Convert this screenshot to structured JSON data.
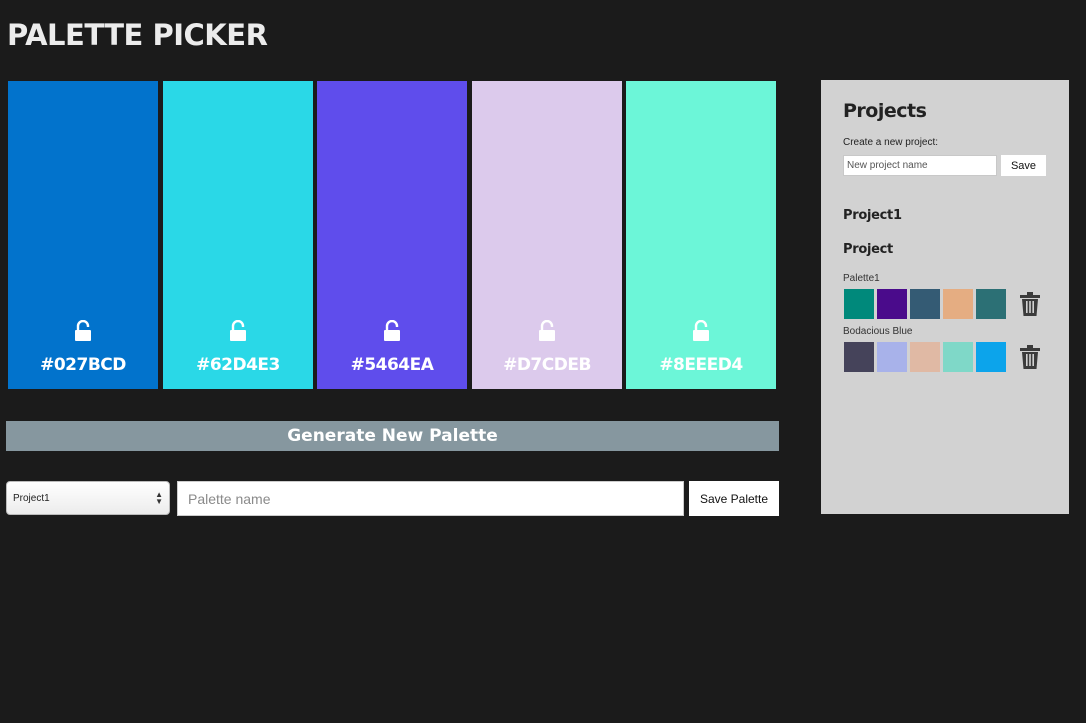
{
  "app": {
    "title": "PALETTE PICKER"
  },
  "swatches": [
    {
      "color": "#0273CC",
      "hex": "#027BCD",
      "icon": "unlock-icon"
    },
    {
      "color": "#2AD8E7",
      "hex": "#62D4E3",
      "icon": "unlock-icon"
    },
    {
      "color": "#5F4DEC",
      "hex": "#5464EA",
      "icon": "unlock-icon"
    },
    {
      "color": "#DCCAEC",
      "hex": "#D7CDEB",
      "icon": "unlock-icon"
    },
    {
      "color": "#6CF6D8",
      "hex": "#8EEED4",
      "icon": "unlock-icon"
    }
  ],
  "controls": {
    "generate_label": "Generate New Palette",
    "project_select_value": "Project1",
    "palette_name_placeholder": "Palette name",
    "save_palette_label": "Save Palette"
  },
  "sidebar": {
    "heading": "Projects",
    "create_label": "Create a new project:",
    "new_project_placeholder": "New project name",
    "save_label": "Save",
    "projects": [
      {
        "name": "Project1",
        "palettes": []
      },
      {
        "name": "Project",
        "palettes": [
          {
            "name": "Palette1",
            "colors": [
              "#00897B",
              "#4A0B8B",
              "#345B74",
              "#E5AD82",
              "#2C7075"
            ],
            "icon": "trash-icon"
          },
          {
            "name": "Bodacious Blue",
            "colors": [
              "#45435A",
              "#A8B2EA",
              "#E0B9A4",
              "#7FD8C8",
              "#0CA4EB"
            ],
            "icon": "trash-icon"
          }
        ]
      }
    ]
  }
}
